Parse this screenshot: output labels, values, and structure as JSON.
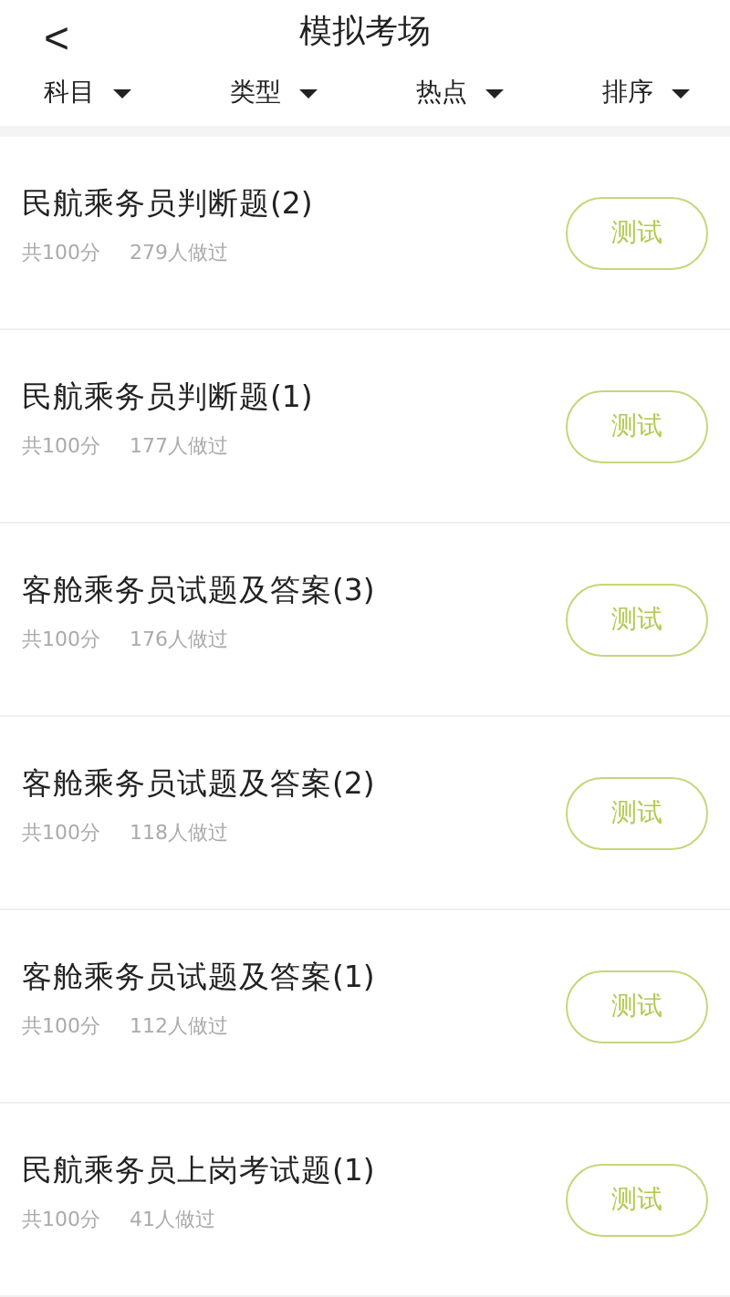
{
  "header": {
    "back": "<",
    "title": "模拟考场"
  },
  "filters": [
    {
      "label": "科目"
    },
    {
      "label": "类型"
    },
    {
      "label": "热点"
    },
    {
      "label": "排序"
    }
  ],
  "exams": [
    {
      "title": "民航乘务员判断题(2)",
      "score": "共100分",
      "taken": "279人做过",
      "action": "测试"
    },
    {
      "title": "民航乘务员判断题(1)",
      "score": "共100分",
      "taken": "177人做过",
      "action": "测试"
    },
    {
      "title": "客舱乘务员试题及答案(3)",
      "score": "共100分",
      "taken": "176人做过",
      "action": "测试"
    },
    {
      "title": "客舱乘务员试题及答案(2)",
      "score": "共100分",
      "taken": "118人做过",
      "action": "测试"
    },
    {
      "title": "客舱乘务员试题及答案(1)",
      "score": "共100分",
      "taken": "112人做过",
      "action": "测试"
    },
    {
      "title": "民航乘务员上岗考试题(1)",
      "score": "共100分",
      "taken": "41人做过",
      "action": "测试"
    }
  ]
}
